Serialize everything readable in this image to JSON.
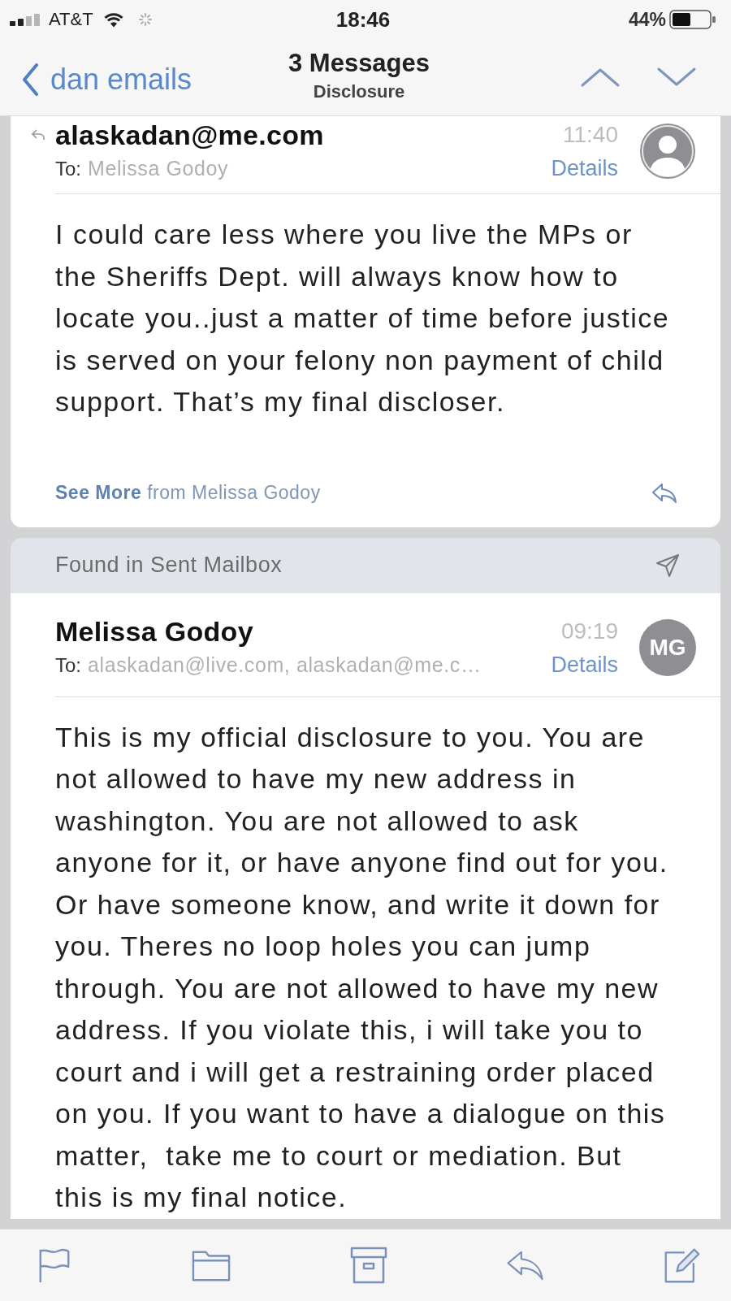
{
  "status_bar": {
    "carrier": "AT&T",
    "time": "18:46",
    "battery": "44%"
  },
  "nav": {
    "back": "dan emails",
    "title": "3 Messages",
    "subtitle": "Disclosure"
  },
  "messages": [
    {
      "replied": true,
      "sender": "alaskadan@me.com",
      "time": "11:40",
      "to_label": "To:",
      "to": "Melissa Godoy",
      "details": "Details",
      "avatar": {
        "kind": "silhouette"
      },
      "body": "I could care less where you live the MPs or the Sheriffs Dept. will always know how to locate you..just a matter of time before justice is served on your felony non payment of child support. That’s my final discloser.",
      "see_more": "**See More** from Melissa Godoy"
    },
    {
      "found_in": "Found in Sent Mailbox",
      "replied": false,
      "sender": "Melissa Godoy",
      "time": "09:19",
      "to_label": "To:",
      "to": "alaskadan@live.com, alaskadan@me.c…",
      "details": "Details",
      "avatar": {
        "kind": "initials",
        "initials": "MG"
      },
      "body": "This is my official disclosure to you. You are not allowed to have my new address in washington. You are not allowed to ask anyone for it, or have anyone find out for you. Or have someone know, and write it down for you. Theres no loop holes you can jump through. You are not allowed to have my new address. If you violate this, i will take you to court and i will get a restraining order placed on you. If you want to have a dialogue on this matter,  take me to court or mediation. But this is my final notice."
    }
  ]
}
